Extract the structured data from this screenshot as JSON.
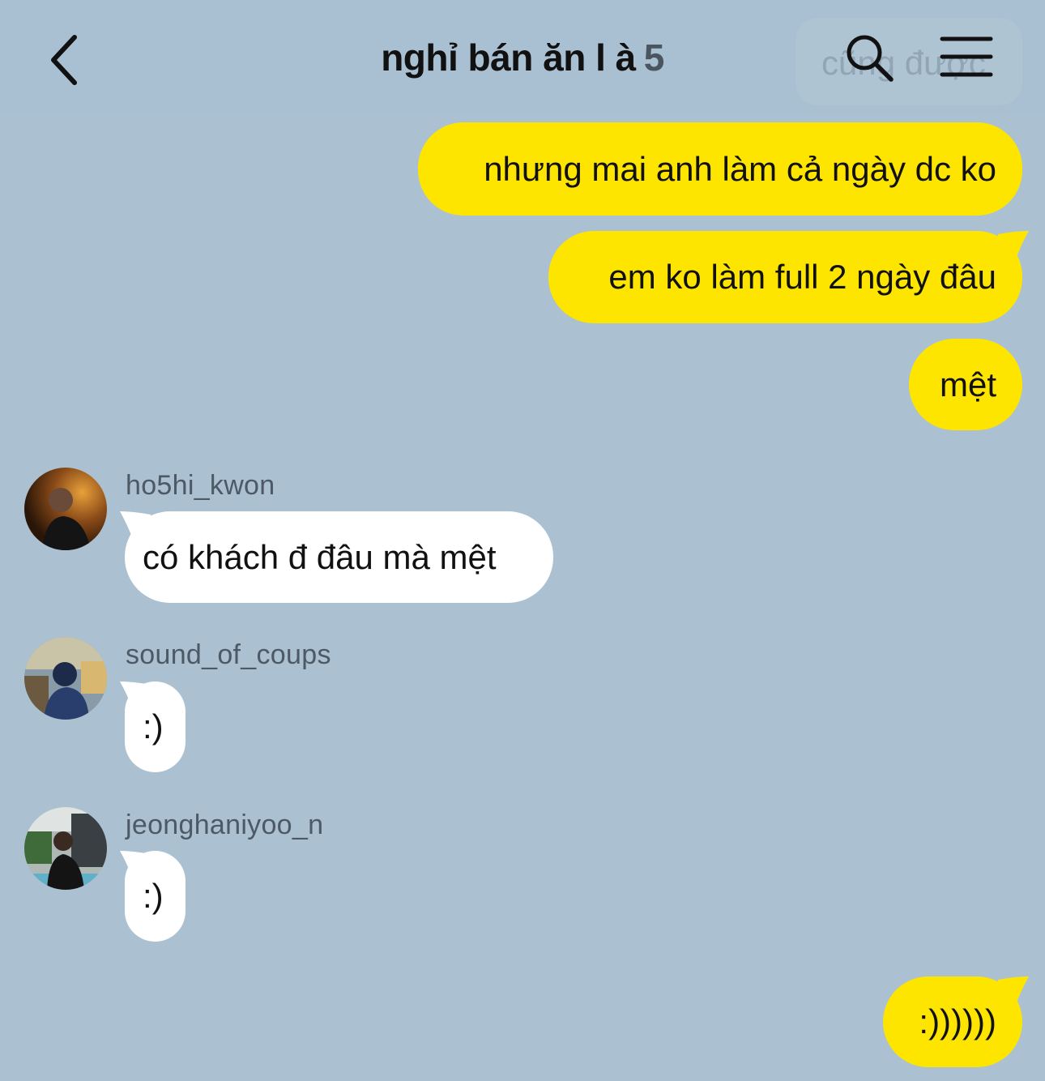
{
  "header": {
    "title": "nghỉ bán ăn l à",
    "member_count": "5",
    "ghost_text": "cũng được"
  },
  "icons": {
    "back": "chevron-left-icon",
    "search": "search-icon",
    "menu": "hamburger-menu-icon"
  },
  "colors": {
    "background": "#abc1d1",
    "my_bubble": "#fee500",
    "their_bubble": "#ffffff"
  },
  "messages": [
    {
      "sender": "me",
      "text": "nhưng mai anh làm cả ngày dc ko"
    },
    {
      "sender": "me",
      "text": "em ko làm full 2 ngày đâu"
    },
    {
      "sender": "me",
      "text": "mệt"
    },
    {
      "sender": "ho5hi_kwon",
      "username": "ho5hi_kwon",
      "text": "có khách đ đâu mà mệt"
    },
    {
      "sender": "sound_of_coups",
      "username": "sound_of_coups",
      "text": ":)"
    },
    {
      "sender": "jeonghaniyoo_n",
      "username": "jeonghaniyoo_n",
      "text": ":)"
    },
    {
      "sender": "me",
      "text": ":))))))"
    }
  ]
}
